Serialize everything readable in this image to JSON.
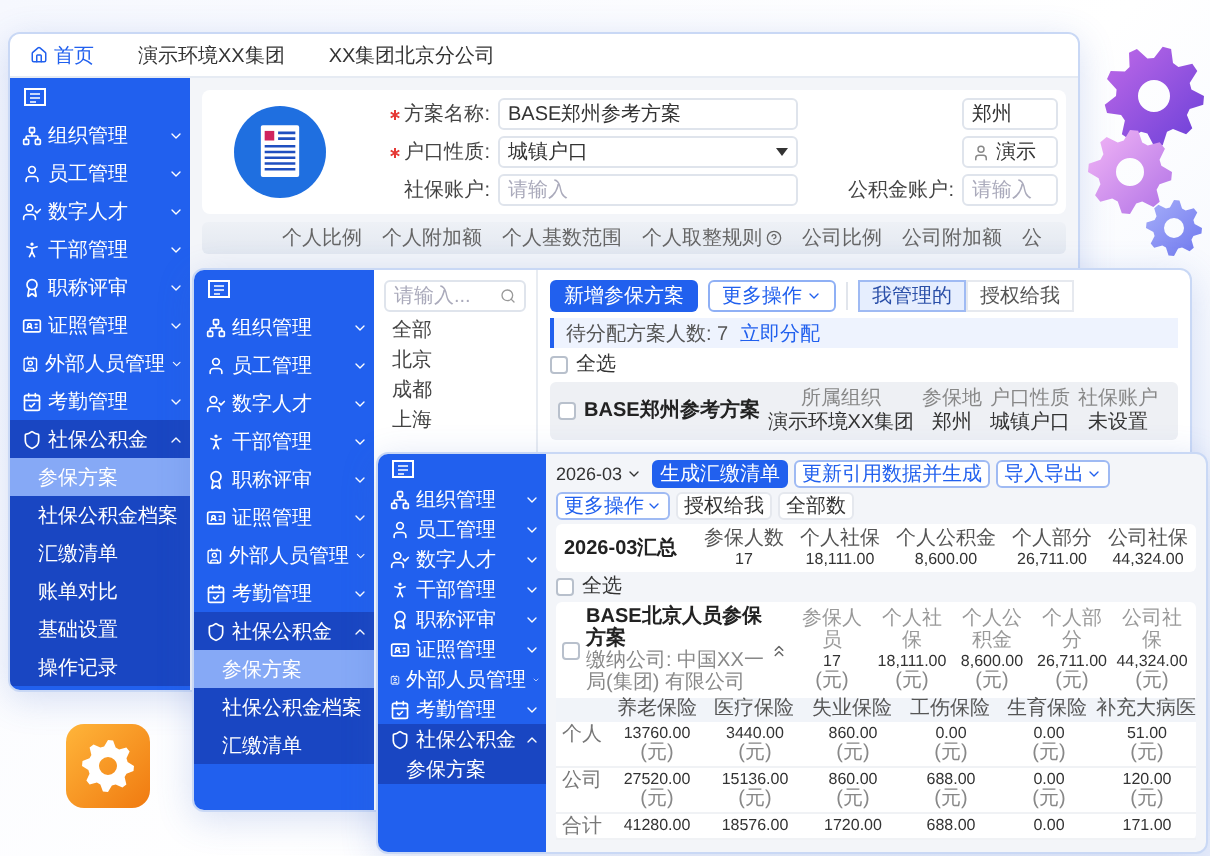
{
  "back_window": {
    "header": {
      "home": "首页",
      "org_tabs": [
        "演示环境XX集团",
        "XX集团北京分公司"
      ]
    },
    "sidebar": [
      {
        "label": "组织管理",
        "expanded": false
      },
      {
        "label": "员工管理",
        "expanded": false
      },
      {
        "label": "数字人才",
        "expanded": false
      },
      {
        "label": "干部管理",
        "expanded": false
      },
      {
        "label": "职称评审",
        "expanded": false
      },
      {
        "label": "证照管理",
        "expanded": false
      },
      {
        "label": "外部人员管理",
        "expanded": false
      },
      {
        "label": "考勤管理",
        "expanded": false
      },
      {
        "label": "社保公积金",
        "expanded": true,
        "children": [
          {
            "label": "参保方案",
            "selected": true
          },
          {
            "label": "社保公积金档案",
            "selected": false
          },
          {
            "label": "汇缴清单",
            "selected": false
          },
          {
            "label": "账单对比",
            "selected": false
          },
          {
            "label": "基础设置",
            "selected": false
          },
          {
            "label": "操作记录",
            "selected": false
          }
        ]
      }
    ],
    "form": {
      "fields": [
        {
          "label": "方案名称:",
          "required": true,
          "kind": "text",
          "value": "BASE郑州参考方案"
        },
        {
          "label": "户口性质:",
          "required": true,
          "kind": "select",
          "value": "城镇户口"
        },
        {
          "label": "社保账户:",
          "required": false,
          "kind": "text",
          "placeholder": "请输入"
        }
      ],
      "side_fields": [
        {
          "kind": "text",
          "value": "郑州"
        },
        {
          "kind": "person",
          "value": "演示"
        },
        {
          "kind": "text",
          "label": "公积金账户:",
          "placeholder": "请输入"
        }
      ]
    },
    "table_columns": [
      {
        "label": "个人比例",
        "help": false
      },
      {
        "label": "个人附加额",
        "help": false
      },
      {
        "label": "个人基数范围",
        "help": false
      },
      {
        "label": "个人取整规则",
        "help": true
      },
      {
        "label": "公司比例",
        "help": false
      },
      {
        "label": "公司附加额",
        "help": false
      },
      {
        "label": "公",
        "help": false
      }
    ]
  },
  "middle_window": {
    "sidebar": [
      {
        "label": "组织管理",
        "expanded": false
      },
      {
        "label": "员工管理",
        "expanded": false
      },
      {
        "label": "数字人才",
        "expanded": false
      },
      {
        "label": "干部管理",
        "expanded": false
      },
      {
        "label": "职称评审",
        "expanded": false
      },
      {
        "label": "证照管理",
        "expanded": false
      },
      {
        "label": "外部人员管理",
        "expanded": false
      },
      {
        "label": "考勤管理",
        "expanded": false
      },
      {
        "label": "社保公积金",
        "expanded": true,
        "children": [
          {
            "label": "参保方案",
            "selected": true
          },
          {
            "label": "社保公积金档案",
            "selected": false
          },
          {
            "label": "汇缴清单",
            "selected": false
          }
        ]
      }
    ],
    "tree": {
      "search_placeholder": "请输入...",
      "items": [
        "全部",
        "北京",
        "成都",
        "上海"
      ]
    },
    "toolbar": {
      "primary": "新增参保方案",
      "more": "更多操作",
      "segments": [
        {
          "label": "我管理的",
          "selected": true
        },
        {
          "label": "授权给我",
          "selected": false
        }
      ]
    },
    "notice": {
      "text": "待分配方案人数: 7",
      "link": "立即分配"
    },
    "select_all": {
      "label": "全选",
      "checked": false
    },
    "plan": {
      "title": "BASE郑州参考方案",
      "checked": false,
      "fields": [
        {
          "label": "所属组织",
          "value": "演示环境XX集团"
        },
        {
          "label": "参保地",
          "value": "郑州"
        },
        {
          "label": "户口性质",
          "value": "城镇户口"
        },
        {
          "label": "社保账户",
          "value": "未设置"
        }
      ]
    }
  },
  "front_window": {
    "sidebar": [
      {
        "label": "组织管理",
        "expanded": false
      },
      {
        "label": "员工管理",
        "expanded": false
      },
      {
        "label": "数字人才",
        "expanded": false
      },
      {
        "label": "干部管理",
        "expanded": false
      },
      {
        "label": "职称评审",
        "expanded": false
      },
      {
        "label": "证照管理",
        "expanded": false
      },
      {
        "label": "外部人员管理",
        "expanded": false
      },
      {
        "label": "考勤管理",
        "expanded": false
      },
      {
        "label": "社保公积金",
        "expanded": true,
        "children": [
          {
            "label": "参保方案",
            "selected": false
          }
        ]
      }
    ],
    "toolbar": {
      "month": "2026-03",
      "buttons": [
        {
          "label": "生成汇缴清单",
          "kind": "primary"
        },
        {
          "label": "更新引用数据并生成",
          "kind": "outline"
        },
        {
          "label": "导入导出",
          "kind": "dropdown"
        },
        {
          "label": "更多操作",
          "kind": "dropdown"
        },
        {
          "label": "授权给我",
          "kind": "plain"
        },
        {
          "label": "全部数",
          "kind": "plain"
        }
      ]
    },
    "summary": {
      "title": "2026-03汇总",
      "stats": [
        {
          "label": "参保人数",
          "value": "17"
        },
        {
          "label": "个人社保",
          "value": "18,111.00"
        },
        {
          "label": "个人公积金",
          "value": "8,600.00"
        },
        {
          "label": "个人部分",
          "value": "26,711.00"
        },
        {
          "label": "公司社保",
          "value": "44,324.00"
        }
      ]
    },
    "select_all": {
      "label": "全选",
      "checked": false
    },
    "plan": {
      "title": "BASE北京人员参保方案",
      "company": "缴纳公司: 中国XX一局(集团) 有限公司",
      "checked": false,
      "stats": [
        {
          "label": "参保人员",
          "value": "17",
          "unit": "(元)"
        },
        {
          "label": "个人社保",
          "value": "18,111.00",
          "unit": "(元)"
        },
        {
          "label": "个人公积金",
          "value": "8,600.00",
          "unit": "(元)"
        },
        {
          "label": "个人部分",
          "value": "26,711.00",
          "unit": "(元)"
        },
        {
          "label": "公司社保",
          "value": "44,324.00",
          "unit": "(元)"
        }
      ]
    },
    "table": {
      "columns": [
        "养老保险",
        "医疗保险",
        "失业保险",
        "工伤保险",
        "生育保险",
        "补充大病医"
      ],
      "rows": [
        {
          "label": "个人",
          "cells": [
            {
              "value": "13760.00",
              "unit": "(元)"
            },
            {
              "value": "3440.00",
              "unit": "(元)"
            },
            {
              "value": "860.00",
              "unit": "(元)"
            },
            {
              "value": "0.00",
              "unit": "(元)"
            },
            {
              "value": "0.00",
              "unit": "(元)"
            },
            {
              "value": "51.00",
              "unit": "(元)"
            }
          ]
        },
        {
          "label": "公司",
          "cells": [
            {
              "value": "27520.00",
              "unit": "(元)"
            },
            {
              "value": "15136.00",
              "unit": "(元)"
            },
            {
              "value": "860.00",
              "unit": "(元)"
            },
            {
              "value": "688.00",
              "unit": "(元)"
            },
            {
              "value": "0.00",
              "unit": "(元)"
            },
            {
              "value": "120.00",
              "unit": "(元)"
            }
          ]
        },
        {
          "label": "合计",
          "cells": [
            {
              "value": "41280.00"
            },
            {
              "value": "18576.00"
            },
            {
              "value": "1720.00"
            },
            {
              "value": "688.00"
            },
            {
              "value": "0.00"
            },
            {
              "value": "171.00"
            }
          ]
        }
      ]
    }
  }
}
